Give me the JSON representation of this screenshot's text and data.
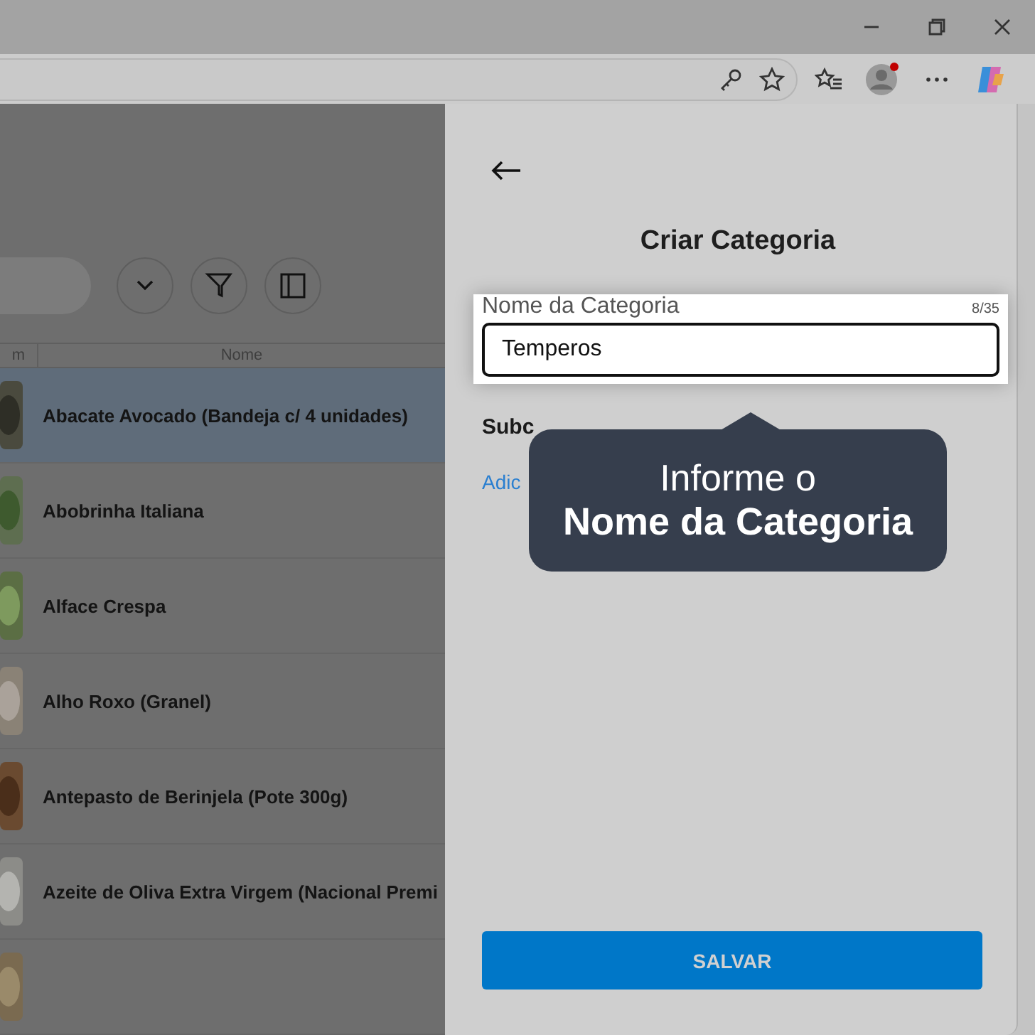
{
  "table": {
    "columns": [
      "m",
      "Nome"
    ],
    "rows": [
      {
        "name": "Abacate Avocado (Bandeja c/ 4 unidades)",
        "selected": true
      },
      {
        "name": "Abobrinha Italiana",
        "selected": false
      },
      {
        "name": "Alface Crespa",
        "selected": false
      },
      {
        "name": "Alho Roxo (Granel)",
        "selected": false
      },
      {
        "name": "Antepasto de Berinjela (Pote 300g)",
        "selected": false
      },
      {
        "name": "Azeite de Oliva Extra Virgem (Nacional Premi",
        "selected": false
      },
      {
        "selected": false
      }
    ]
  },
  "panel": {
    "title": "Criar Categoria",
    "field": {
      "label": "Nome da Categoria",
      "counter": "8/35",
      "value": "Temperos"
    },
    "section_label": "Subc",
    "link": "Adic",
    "save_button": "SALVAR"
  },
  "tooltip": {
    "line_1": "Informe o",
    "line_2": "Nome da Categoria"
  }
}
